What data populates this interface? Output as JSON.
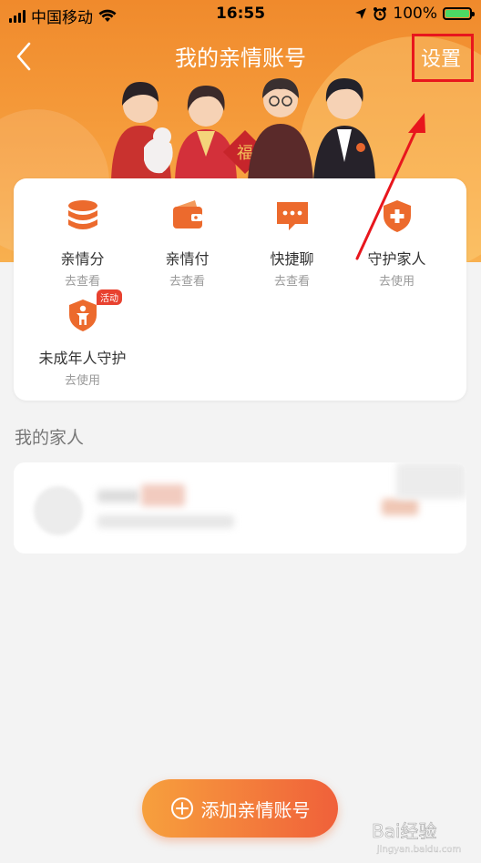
{
  "status_bar": {
    "carrier": "中国移动",
    "time": "16:55",
    "battery": "100%"
  },
  "header": {
    "title": "我的亲情账号",
    "settings_label": "设置"
  },
  "services": [
    {
      "name": "亲情分",
      "action": "去查看",
      "icon": "coin-stack-icon"
    },
    {
      "name": "亲情付",
      "action": "去查看",
      "icon": "wallet-icon"
    },
    {
      "name": "快捷聊",
      "action": "去查看",
      "icon": "chat-bubble-icon"
    },
    {
      "name": "守护家人",
      "action": "去使用",
      "icon": "shield-plus-icon"
    },
    {
      "name": "未成年人守护",
      "action": "去使用",
      "icon": "shield-child-icon",
      "badge": "活动"
    }
  ],
  "family": {
    "section_title": "我的家人"
  },
  "add_button": {
    "label": "添加亲情账号"
  },
  "watermark": {
    "text": "Bai经验",
    "sub": "jingyan.baidu.com"
  },
  "colors": {
    "brand_orange": "#f28b2c",
    "annotation_red": "#e8161d",
    "button_end": "#f0603a"
  }
}
